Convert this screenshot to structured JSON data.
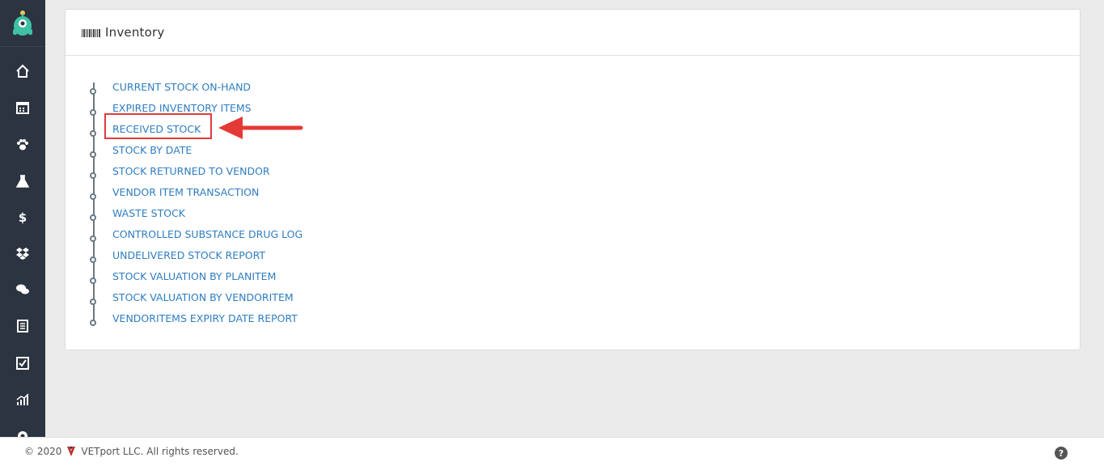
{
  "sidebar": {
    "items": [
      {
        "icon": "home-icon"
      },
      {
        "icon": "calendar-icon"
      },
      {
        "icon": "paw-icon"
      },
      {
        "icon": "flask-icon"
      },
      {
        "icon": "dollar-icon"
      },
      {
        "icon": "dropbox-icon"
      },
      {
        "icon": "comments-icon"
      },
      {
        "icon": "receipt-icon"
      },
      {
        "icon": "checkbox-icon"
      },
      {
        "icon": "chart-icon"
      },
      {
        "icon": "gear-icon"
      }
    ]
  },
  "panel": {
    "title": "Inventory",
    "links": [
      "CURRENT STOCK ON-HAND",
      "EXPIRED INVENTORY ITEMS",
      "RECEIVED STOCK",
      "STOCK BY DATE",
      "STOCK RETURNED TO VENDOR",
      "VENDOR ITEM TRANSACTION",
      "WASTE STOCK",
      "CONTROLLED SUBSTANCE DRUG LOG",
      "UNDELIVERED STOCK REPORT",
      "STOCK VALUATION BY PLANITEM",
      "STOCK VALUATION BY VENDORITEM",
      "VENDORITEMS EXPIRY DATE REPORT"
    ],
    "highlighted_link": "RECEIVED STOCK"
  },
  "footer": {
    "copyright": "© 2020",
    "company": "VETport LLC. All rights reserved.",
    "help": "?"
  },
  "colors": {
    "sidebar_bg": "#2b3440",
    "link": "#2e7dc2",
    "highlight": "#e03b3b",
    "page_bg": "#ebebeb"
  }
}
